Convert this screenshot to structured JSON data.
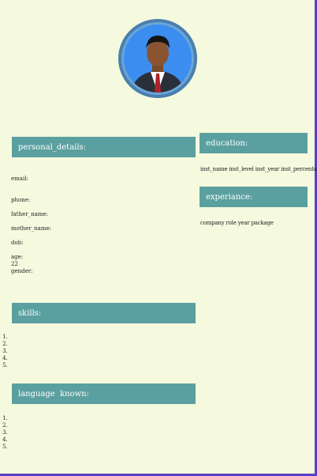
{
  "sections": {
    "personal_details": "personal_details:",
    "education": "education:",
    "experience": "experiance:",
    "skills": "skills:",
    "language_known": "language  known:"
  },
  "personal_fields": {
    "email": "email:",
    "phone": "phone:",
    "father_name": "father_name:",
    "mother_name": "mother_name:",
    "dob": "dob:",
    "age": "age:",
    "age_value": "22",
    "gender": "gender:"
  },
  "education_columns": "inst_name inst_level inst_year inst_percentage",
  "experience_columns": "company role year package",
  "skills_items": [
    "",
    "",
    "",
    "",
    ""
  ],
  "language_items": [
    "",
    "",
    "",
    "",
    ""
  ],
  "colors": {
    "background": "#f5fadf",
    "section_bar": "#5ba0a0",
    "frame": "#5a3fc6"
  },
  "icons": {
    "profile": "profile-photo"
  }
}
